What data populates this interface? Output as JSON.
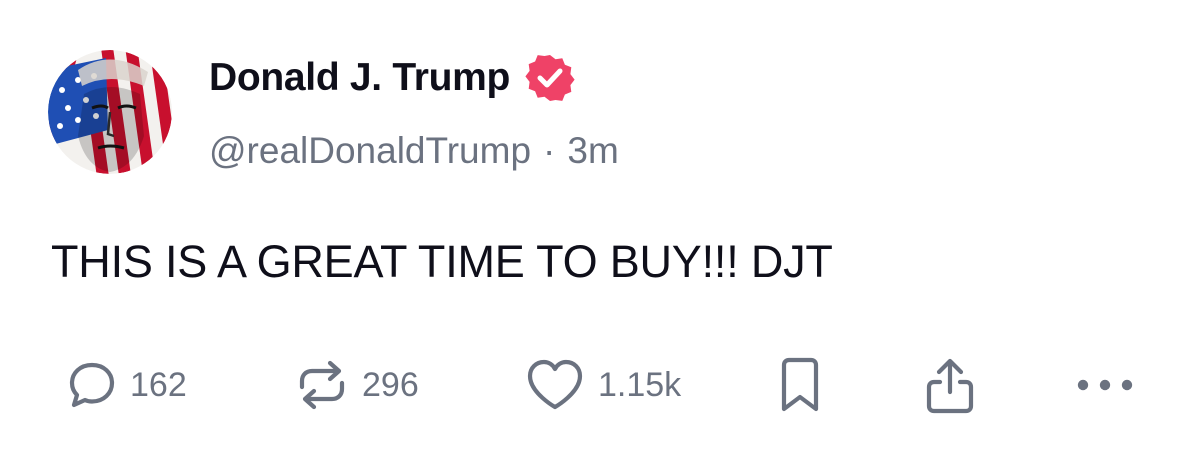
{
  "post": {
    "author": {
      "display_name": "Donald J. Trump",
      "handle": "@realDonaldTrump",
      "verified": true,
      "avatar": "flag-painted-portrait"
    },
    "separator": "·",
    "timestamp": "3m",
    "text": "THIS IS A GREAT TIME TO BUY!!! DJT"
  },
  "actions": {
    "replies": "162",
    "reposts": "296",
    "likes": "1.15k"
  },
  "icons": {
    "reply": "reply-icon",
    "repost": "repost-icon",
    "like": "heart-icon",
    "bookmark": "bookmark-icon",
    "share": "share-icon",
    "more": "more-icon",
    "verified": "verified-badge-icon"
  },
  "colors": {
    "text": "#0f0f1a",
    "muted": "#6b7280",
    "verified_badge": "#ef4267",
    "flag_red": "#c8102e",
    "flag_blue": "#1f4fb4"
  }
}
